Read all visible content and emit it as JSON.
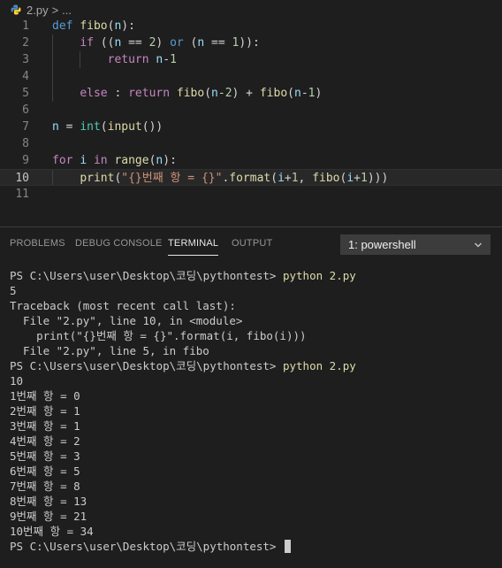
{
  "breadcrumb": {
    "file": "2.py",
    "separator": ">",
    "rest": "..."
  },
  "code_lines": [
    {
      "num": "1",
      "segs": [
        {
          "t": "def",
          "c": "kw"
        },
        {
          "t": " "
        },
        {
          "t": "fibo",
          "c": "fn"
        },
        {
          "t": "("
        },
        {
          "t": "n",
          "c": "var"
        },
        {
          "t": "):"
        }
      ]
    },
    {
      "num": "2",
      "indent": 1,
      "segs": [
        {
          "t": "    "
        },
        {
          "t": "if",
          "c": "ctl"
        },
        {
          "t": " (("
        },
        {
          "t": "n",
          "c": "var"
        },
        {
          "t": " == "
        },
        {
          "t": "2",
          "c": "num"
        },
        {
          "t": ") "
        },
        {
          "t": "or",
          "c": "kw"
        },
        {
          "t": " ("
        },
        {
          "t": "n",
          "c": "var"
        },
        {
          "t": " == "
        },
        {
          "t": "1",
          "c": "num"
        },
        {
          "t": ")):"
        }
      ]
    },
    {
      "num": "3",
      "indent": 2,
      "segs": [
        {
          "t": "        "
        },
        {
          "t": "return",
          "c": "ctl"
        },
        {
          "t": " "
        },
        {
          "t": "n",
          "c": "var"
        },
        {
          "t": "-"
        },
        {
          "t": "1",
          "c": "num"
        }
      ]
    },
    {
      "num": "4",
      "indent": 1,
      "segs": []
    },
    {
      "num": "5",
      "indent": 1,
      "segs": [
        {
          "t": "    "
        },
        {
          "t": "else",
          "c": "ctl"
        },
        {
          "t": " : "
        },
        {
          "t": "return",
          "c": "ctl"
        },
        {
          "t": " "
        },
        {
          "t": "fibo",
          "c": "fn"
        },
        {
          "t": "("
        },
        {
          "t": "n",
          "c": "var"
        },
        {
          "t": "-"
        },
        {
          "t": "2",
          "c": "num"
        },
        {
          "t": ") + "
        },
        {
          "t": "fibo",
          "c": "fn"
        },
        {
          "t": "("
        },
        {
          "t": "n",
          "c": "var"
        },
        {
          "t": "-"
        },
        {
          "t": "1",
          "c": "num"
        },
        {
          "t": ")"
        }
      ]
    },
    {
      "num": "6",
      "segs": []
    },
    {
      "num": "7",
      "segs": [
        {
          "t": "n",
          "c": "var"
        },
        {
          "t": " = "
        },
        {
          "t": "int",
          "c": "bi"
        },
        {
          "t": "("
        },
        {
          "t": "input",
          "c": "fn"
        },
        {
          "t": "())"
        }
      ]
    },
    {
      "num": "8",
      "segs": []
    },
    {
      "num": "9",
      "segs": [
        {
          "t": "for",
          "c": "ctl"
        },
        {
          "t": " "
        },
        {
          "t": "i",
          "c": "var"
        },
        {
          "t": " "
        },
        {
          "t": "in",
          "c": "ctl"
        },
        {
          "t": " "
        },
        {
          "t": "range",
          "c": "fn"
        },
        {
          "t": "("
        },
        {
          "t": "n",
          "c": "var"
        },
        {
          "t": "):"
        }
      ]
    },
    {
      "num": "10",
      "active": true,
      "indent": 1,
      "segs": [
        {
          "t": "    "
        },
        {
          "t": "print",
          "c": "fn"
        },
        {
          "t": "("
        },
        {
          "t": "\"{}번째 항 = {}\"",
          "c": "str"
        },
        {
          "t": "."
        },
        {
          "t": "format",
          "c": "fn"
        },
        {
          "t": "("
        },
        {
          "t": "i",
          "c": "var"
        },
        {
          "t": "+"
        },
        {
          "t": "1",
          "c": "num"
        },
        {
          "t": ", "
        },
        {
          "t": "fibo",
          "c": "fn"
        },
        {
          "t": "("
        },
        {
          "t": "i",
          "c": "var"
        },
        {
          "t": "+"
        },
        {
          "t": "1",
          "c": "num"
        },
        {
          "t": ")))"
        }
      ]
    },
    {
      "num": "11",
      "segs": []
    }
  ],
  "panel": {
    "tabs": [
      "PROBLEMS",
      "DEBUG CONSOLE",
      "TERMINAL",
      "OUTPUT"
    ],
    "active_tab": "TERMINAL",
    "terminal_select": "1: powershell"
  },
  "terminal_lines": [
    {
      "prompt": "PS C:\\Users\\user\\Desktop\\코딩\\pythontest> ",
      "cmd": "python 2.py"
    },
    {
      "text": "5"
    },
    {
      "text": "Traceback (most recent call last):"
    },
    {
      "text": "  File \"2.py\", line 10, in <module>"
    },
    {
      "text": "    print(\"{}번째 항 = {}\".format(i, fibo(i)))"
    },
    {
      "text": "  File \"2.py\", line 5, in fibo"
    },
    {
      "prompt": "PS C:\\Users\\user\\Desktop\\코딩\\pythontest> ",
      "cmd": "python 2.py"
    },
    {
      "text": "10"
    },
    {
      "text": "1번째 항 = 0"
    },
    {
      "text": "2번째 항 = 1"
    },
    {
      "text": "3번째 항 = 1"
    },
    {
      "text": "4번째 항 = 2"
    },
    {
      "text": "5번째 항 = 3"
    },
    {
      "text": "6번째 항 = 5"
    },
    {
      "text": "7번째 항 = 8"
    },
    {
      "text": "8번째 항 = 13"
    },
    {
      "text": "9번째 항 = 21"
    },
    {
      "text": "10번째 항 = 34"
    },
    {
      "prompt": "PS C:\\Users\\user\\Desktop\\코딩\\pythontest> ",
      "cursor": true
    }
  ],
  "colors": {
    "background": "#1e1e1e",
    "keyword": "#569cd6",
    "control": "#c586c0",
    "function": "#dcdcaa",
    "number": "#b5cea8",
    "string": "#ce9178",
    "builtin": "#4ec9b0",
    "variable": "#9cdcfe"
  },
  "icons": {
    "file": "python-icon",
    "dropdown": "chevron-down-icon"
  }
}
